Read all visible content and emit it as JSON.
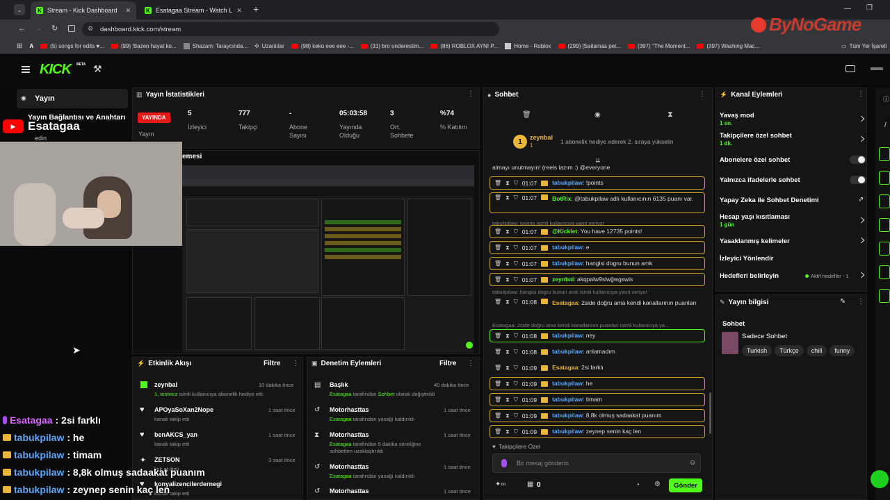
{
  "browser": {
    "tabs": [
      {
        "title": "Stream - Kick Dashboard"
      },
      {
        "title": "Esatagaa Stream - Watch Live o"
      }
    ],
    "url": "dashboard.kick.com/stream",
    "bookmarks": [
      "(5) songs for edits ♥...",
      "(99) 'Bazen hayat ko...",
      "Shazam: Taraycında...",
      "Uzantılar",
      "(98) keko eee eee -...",
      "(31) bro underestim...",
      "(86) ROBLOX AYNI P...",
      "Home - Roblox",
      "(299) [Saitamas pet...",
      "(397) \"The Moment...",
      "(397) Washing Mac..."
    ],
    "all_bookmarks": "Tüm Yer İşareti"
  },
  "watermark": "ByNoGame",
  "kick": {
    "logo": "KICK",
    "beta": "BETA"
  },
  "sidebar": {
    "item1": "Yayın",
    "item2": "Yayın Bağlantısı ve Anahtarı",
    "item2b": "edin"
  },
  "stats": {
    "title": "Yayın İstatistikleri",
    "live_badge": "YAYINDA",
    "live_label": "Yayın",
    "items": [
      {
        "value": "5",
        "label": "İzleyici"
      },
      {
        "value": "777",
        "label": "Takipçi"
      },
      {
        "value": "-",
        "label": "Abone Sayısı"
      },
      {
        "value": "05:03:58",
        "label": "Yayında Olduğu"
      },
      {
        "value": "3",
        "label": "Ort. Sohbete"
      },
      {
        "value": "%74",
        "label": "% Katılım"
      }
    ]
  },
  "preview": {
    "title": "emesi"
  },
  "activity": {
    "title": "Etkinlik Akışı",
    "filter": "Filtre",
    "rows": [
      {
        "name": "zeynbal",
        "line_a": "1, testvicz",
        "line_b": " isimli kullanıcıya abonelik hediye etti.",
        "time": "10 dakika önce"
      },
      {
        "name": "APOyaSoXan2Nope",
        "line": "kanalı takip etti",
        "time": "1 saat önce"
      },
      {
        "name": "benAKCS_yan",
        "line": "kanalı takip etti",
        "time": "1 saat önce"
      },
      {
        "name": "ZETSON",
        "line": "link at dinli",
        "time": "3 saat önce"
      },
      {
        "name": "konyalizencilerdernegi",
        "line": "kanalı takip etti",
        "time": "3 saat önce"
      }
    ]
  },
  "moderation": {
    "title": "Denetim Eylemleri",
    "filter": "Filtre",
    "rows": [
      {
        "name": "Başlık",
        "a": "Esatagaa",
        "b": " tarafından ",
        "c": "Sohbet",
        "d": " olarak değiştirildi",
        "time": "40 dakika önce"
      },
      {
        "name": "Motorhasttas",
        "a": "Esatagaa",
        "b": " tarafından yasağı kaldırıldı",
        "time": "1 saat önce"
      },
      {
        "name": "Motorhasttas",
        "a": "Esatagaa",
        "b": " tarafından 5 dakika süreliğine sohbetten uzaklaştırıldı",
        "time": "1 saat önce"
      },
      {
        "name": "Motorhasttas",
        "a": "Esatagaa",
        "b": " tarafından yasağı kaldırıldı",
        "time": "1 saat önce"
      },
      {
        "name": "Motorhasttas",
        "time": "1 saat önce"
      }
    ]
  },
  "chat": {
    "title": "Sohbet",
    "pinned_user": "zeynbal",
    "pinned_badge": "1",
    "pinned_text": "1 abonelik hediye ederek 2. sıraya yükselin",
    "top_line": "almayı unutmayın! (reels lazım :) @everyone",
    "messages": [
      {
        "time": "01:07",
        "user": "tabukpilaw",
        "text": ": !points"
      },
      {
        "time": "01:07",
        "user": "BotRix",
        "text": ": @tabukpilaw adlı kullanıcının 6135 puanı var."
      },
      {
        "reply": "tabukpilaw: !points isimli kullanıcıya yanıt veriyor"
      },
      {
        "time": "01:07",
        "user": "@Kicklet",
        "text": ": You have 12735 points!"
      },
      {
        "time": "01:07",
        "user": "tabukpilaw",
        "text": ": e"
      },
      {
        "time": "01:07",
        "user": "tabukpilaw",
        "text": ": hangisi dogru bunun amk"
      },
      {
        "time": "01:07",
        "user": "zeynbal",
        "text": ": akqpalw9slwğwgswis"
      },
      {
        "reply": "tabukpilaw: hangisi dogru bunun amk isimli kullanıcıya yanıt veriyor"
      },
      {
        "time": "01:08",
        "user": "Esatagaa",
        "text": ": 2side doğru ama kendi kanallarının puanları"
      },
      {
        "reply": "Esatagaa: 2side doğru ama kendi kanallarının puanları isimli kullanıcıya ya..."
      },
      {
        "time": "01:08",
        "user": "tabukpilaw",
        "text": ": ney"
      },
      {
        "time": "01:08",
        "user": "tabukpilaw",
        "text": ": anlamadım"
      },
      {
        "time": "01:09",
        "user": "Esatagaa",
        "text": ": 2si farklı"
      },
      {
        "time": "01:09",
        "user": "tabukpilaw",
        "text": ": he"
      },
      {
        "time": "01:09",
        "user": "tabukpilaw",
        "text": ": timam"
      },
      {
        "time": "01:09",
        "user": "tabukpilaw",
        "text": ": 8,8k olmuş sadaakat puanım"
      },
      {
        "time": "01:09",
        "user": "tabukpilaw",
        "text": ": zeynep senin kaç len"
      }
    ],
    "followers_only": "Takipçilere Özel",
    "input_placeholder": "Bir mesaj gönderin",
    "count": "0",
    "send": "Gönder"
  },
  "channel_actions": {
    "title": "Kanal Eylemleri",
    "slow_mode": "Yavaş mod",
    "slow_value": "1 sn.",
    "followers_chat": "Takipçilere özel sohbet",
    "followers_value": "1 dk.",
    "subs_chat": "Abonelere özel sohbet",
    "emote_chat": "Yalnızca ifadelerle sohbet",
    "ai_mod": "Yapay Zeka ile Sohbet Denetimi",
    "account_age": "Hesap yaşı kısıtlaması",
    "account_value": "1 gün",
    "banned_words": "Yasaklanmış kelimeler",
    "redirect": "İzleyici Yönlendir",
    "goals": "Hedefleri belirleyin",
    "goals_value": "Aktif hedefler - 1"
  },
  "stream_info": {
    "title": "Yayın bilgisi",
    "category": "Sohbet",
    "stream_title": "Sadece Sohbet",
    "tags": [
      "Turkish",
      "Türkçe",
      "chill",
      "funny"
    ]
  },
  "overlay": {
    "channel": "Esatagaa",
    "lines": [
      {
        "user": "Esatagaa",
        "text": ": 2si farklı"
      },
      {
        "user": "tabukpilaw",
        "text": ": he"
      },
      {
        "user": "tabukpilaw",
        "text": ": timam"
      },
      {
        "user": "tabukpilaw",
        "text": ": 8,8k olmuş sadaakat puanım"
      },
      {
        "user": "tabukpilaw",
        "text": ": zeynep senin kaç len"
      }
    ]
  }
}
